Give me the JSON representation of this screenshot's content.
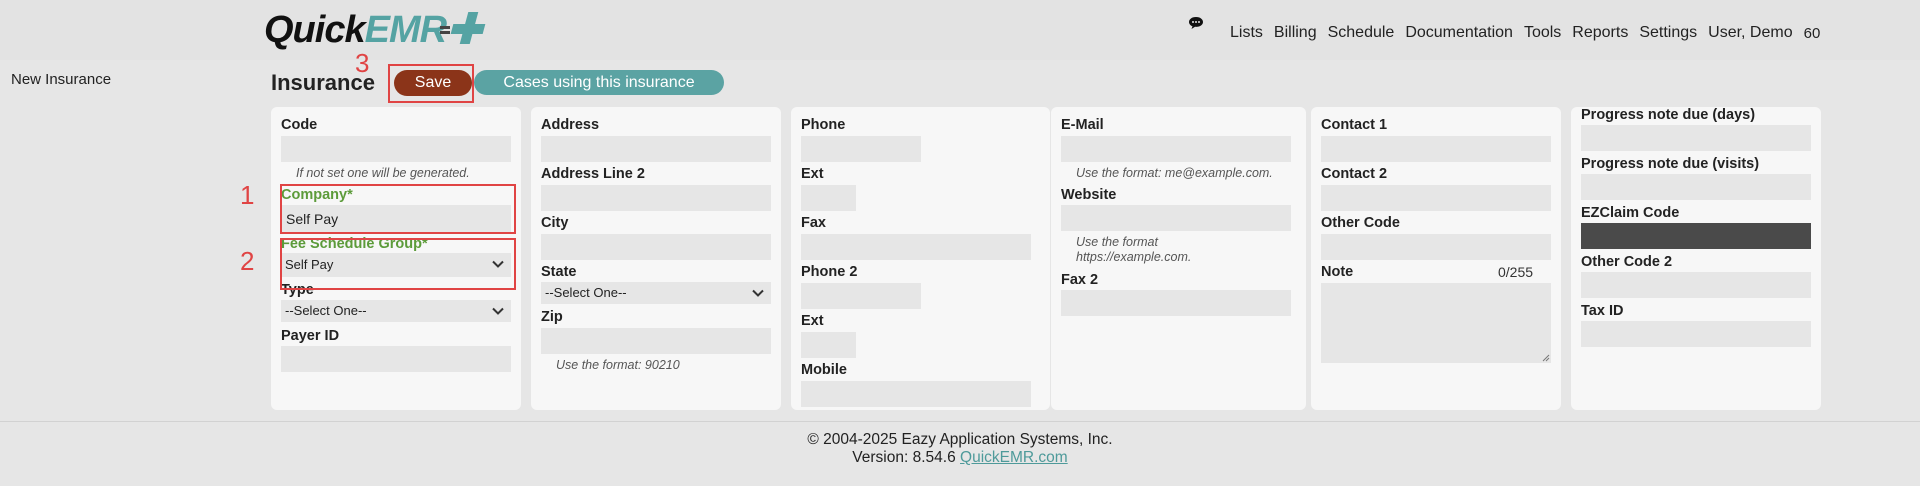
{
  "app": {
    "logo_part1": "Quick",
    "logo_part2": "EMR"
  },
  "nav": [
    "Lists",
    "Billing",
    "Schedule",
    "Documentation",
    "Tools",
    "Reports",
    "Settings",
    "User, Demo",
    "60"
  ],
  "sidebar": {
    "label": "New Insurance"
  },
  "page": {
    "title": "Insurance",
    "save_label": "Save",
    "cases_label": "Cases using this insurance"
  },
  "annotations": [
    "1",
    "2",
    "3"
  ],
  "col1": {
    "code_label": "Code",
    "code_value": "",
    "code_hint": "If not set one will be generated.",
    "company_label": "Company*",
    "company_value": "Self Pay",
    "fee_label": "Fee Schedule Group*",
    "fee_value": "Self Pay",
    "type_label": "Type",
    "type_value": "--Select One--",
    "payer_label": "Payer ID",
    "payer_value": ""
  },
  "col2": {
    "address_label": "Address",
    "address2_label": "Address Line 2",
    "city_label": "City",
    "state_label": "State",
    "state_value": "--Select One--",
    "zip_label": "Zip",
    "zip_hint": "Use the format: 90210"
  },
  "col3": {
    "phone_label": "Phone",
    "ext_label": "Ext",
    "fax_label": "Fax",
    "phone2_label": "Phone 2",
    "ext2_label": "Ext",
    "mobile_label": "Mobile"
  },
  "col4": {
    "email_label": "E-Mail",
    "email_hint": "Use the format: me@example.com.",
    "website_label": "Website",
    "website_hint": "Use the format https://example.com.",
    "fax2_label": "Fax 2"
  },
  "col5": {
    "contact1_label": "Contact 1",
    "contact2_label": "Contact 2",
    "other_code_label": "Other Code",
    "note_label": "Note",
    "note_counter": "0/255"
  },
  "col6": {
    "progress_days_label": "Progress note due (days)",
    "progress_visits_label": "Progress note due (visits)",
    "ezclaim_label": "EZClaim Code",
    "other_code2_label": "Other Code 2",
    "tax_label": "Tax ID"
  },
  "footer": {
    "copyright": "© 2004-2025 Eazy Application Systems, Inc.",
    "version": "Version: 8.54.6",
    "link": "QuickEMR.com"
  },
  "colors": {
    "accent": "#5ba3a3",
    "save": "#8b3419",
    "required": "#5c9b3a",
    "annotation": "#e04444"
  }
}
